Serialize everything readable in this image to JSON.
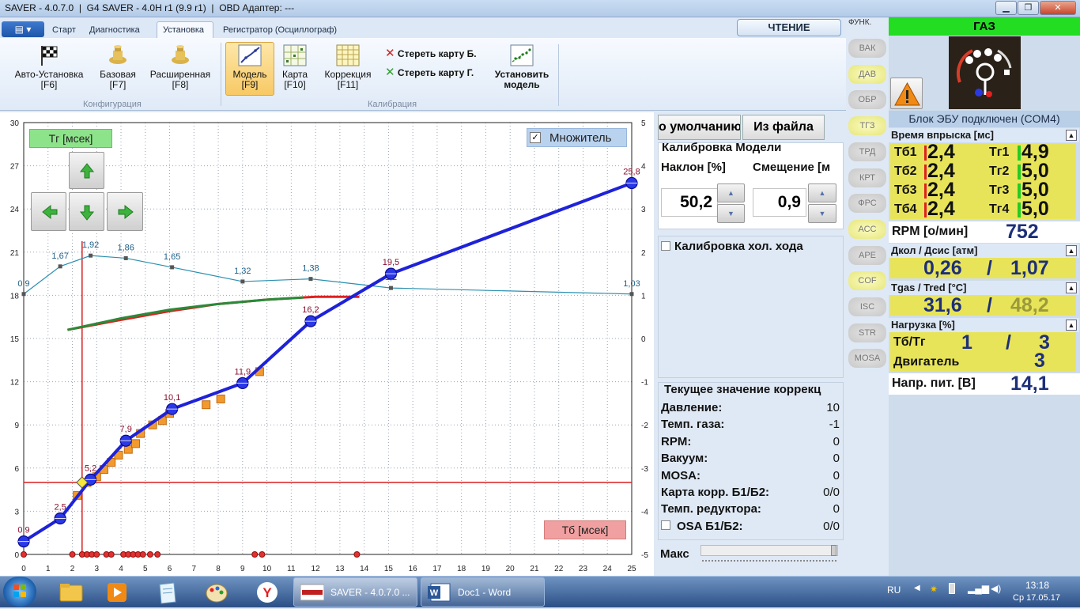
{
  "window": {
    "title": "SAVER - 4.0.7.0  |  G4 SAVER - 4.0H r1 (9.9 r1)  |  OBD Адаптер: ---",
    "min": "▁",
    "max": "❐",
    "close": "✕"
  },
  "ribbon": {
    "file_menu": "▤ ▾",
    "tabs": [
      "Старт",
      "Диагностика",
      "Установка",
      "Регистратор (Осциллограф)"
    ],
    "read_button": "ЧТЕНИЕ",
    "buttons": [
      {
        "label1": "Авто-Установка",
        "label2": "[F6]"
      },
      {
        "label1": "Базовая",
        "label2": "[F7]"
      },
      {
        "label1": "Расширенная",
        "label2": "[F8]"
      },
      {
        "label1": "Модель",
        "label2": "[F9]"
      },
      {
        "label1": "Карта",
        "label2": "[F10]"
      },
      {
        "label1": "Коррекция",
        "label2": "[F11]"
      },
      {
        "label1": "Установить",
        "label2": "модель"
      }
    ],
    "erase_b": "Стереть карту Б.",
    "erase_g": "Стереть карту Г.",
    "group_config": "Конфигурация",
    "group_calib": "Калибрация"
  },
  "chart_overlay": {
    "tg_label": "Тг [мсек]",
    "tb_label": "Тб [мсек]",
    "multiplier_label": "Множитель",
    "multiplier_checked": true
  },
  "chart_data": {
    "type": "line",
    "xlim": [
      0,
      25
    ],
    "ylim_left": [
      0,
      30
    ],
    "ylim_right": [
      -5,
      5
    ],
    "x_ticks": [
      0,
      1,
      2,
      3,
      4,
      5,
      6,
      7,
      8,
      9,
      10,
      11,
      12,
      13,
      14,
      15,
      16,
      17,
      18,
      19,
      20,
      21,
      22,
      23,
      24,
      25
    ],
    "y_ticks_left": [
      0,
      3,
      6,
      9,
      12,
      15,
      18,
      21,
      24,
      27,
      30
    ],
    "y_ticks_right": [
      -5,
      -4,
      -3,
      -2,
      -1,
      0,
      1,
      2,
      3,
      4,
      5
    ],
    "blue_curve": {
      "points": [
        [
          0,
          0.9
        ],
        [
          1.5,
          2.5
        ],
        [
          2.75,
          5.2
        ],
        [
          4.2,
          7.9
        ],
        [
          6.1,
          10.1
        ],
        [
          9,
          11.9
        ],
        [
          11.8,
          16.2
        ],
        [
          15.1,
          19.5
        ],
        [
          25,
          25.8
        ]
      ],
      "labels": [
        "0,9",
        "2,5",
        "5,2",
        "7,9",
        "10,1",
        "11,9",
        "16,2",
        "19,5",
        "25,8"
      ]
    },
    "factor_curve": {
      "points": [
        [
          0,
          1.03
        ],
        [
          1.5,
          1.67
        ],
        [
          2.75,
          1.92
        ],
        [
          4.2,
          1.86
        ],
        [
          6.1,
          1.65
        ],
        [
          9,
          1.32
        ],
        [
          11.8,
          1.38
        ],
        [
          15.1,
          1.17
        ],
        [
          25,
          1.03
        ]
      ],
      "labels": [
        "0,9",
        "1,67",
        "1,92",
        "1,86",
        "1,65",
        "1,32",
        "1,38",
        "1,2",
        "1,03"
      ]
    },
    "green_curve": {
      "points": [
        [
          1.8,
          15.6
        ],
        [
          4,
          16.4
        ],
        [
          6,
          17
        ],
        [
          8,
          17.4
        ],
        [
          10,
          17.7
        ],
        [
          11.5,
          17.85
        ]
      ]
    },
    "red_curve": {
      "points": [
        [
          1.8,
          15.6
        ],
        [
          4,
          16.3
        ],
        [
          6,
          16.9
        ],
        [
          8,
          17.4
        ],
        [
          10,
          17.7
        ],
        [
          12,
          17.9
        ],
        [
          13.8,
          17.9
        ]
      ]
    },
    "orange_squares": [
      [
        2.2,
        4.1
      ],
      [
        2.6,
        5
      ],
      [
        3.0,
        5.4
      ],
      [
        3.3,
        5.9
      ],
      [
        3.6,
        6.4
      ],
      [
        3.9,
        6.9
      ],
      [
        4.3,
        7.3
      ],
      [
        4.6,
        7.7
      ],
      [
        4.8,
        8.4
      ],
      [
        5.3,
        9.0
      ],
      [
        5.7,
        9.3
      ],
      [
        6.0,
        9.8
      ],
      [
        7.5,
        10.4
      ],
      [
        8.1,
        10.8
      ],
      [
        9.7,
        12.7
      ]
    ],
    "red_dots_x": [
      0,
      2.0,
      2.4,
      2.6,
      2.8,
      3.0,
      3.4,
      3.6,
      4.1,
      4.3,
      4.5,
      4.7,
      4.9,
      5.2,
      5.5,
      9.5,
      9.8,
      13.7
    ],
    "crosshair": {
      "x": 2.4,
      "y": 5.0
    }
  },
  "mid": {
    "btn_default": "о умолчанию",
    "btn_file": "Из файла",
    "calib_title": "Калибровка Модели",
    "slope_label": "Наклон [%]",
    "offset_label": "Смещение [м",
    "slope_value": "50,2",
    "offset_value": "0,9",
    "idle_calib": "Калибровка хол. хода",
    "corr_title": "Текущее значение коррекц",
    "rows": [
      [
        "Давление:",
        "10"
      ],
      [
        "Темп. газа:",
        "-1"
      ],
      [
        "RPM:",
        "0"
      ],
      [
        "Вакуум:",
        "0"
      ],
      [
        "MOSA:",
        "0"
      ],
      [
        "Карта корр. Б1/Б2:",
        "0/0"
      ],
      [
        "Темп. редуктора:",
        "0"
      ],
      [
        "OSA Б1/Б2:",
        "0/0"
      ]
    ],
    "max_label": "Макс"
  },
  "funk": {
    "title": "ФУНК.",
    "items": [
      "ВАК",
      "ДАВ",
      "ОБР",
      "ТГЗ",
      "ТРД",
      "КРТ",
      "ФРС",
      "АСС",
      "АРЕ",
      "COF",
      "ISC",
      "STR",
      "MOSA"
    ]
  },
  "right": {
    "gas_title": "ГАЗ",
    "ecu_status": "Блок ЭБУ подключен (COM4)",
    "inj_title": "Время впрыска [мс]",
    "tb": [
      [
        "Тб1",
        "2,4"
      ],
      [
        "Тб2",
        "2,4"
      ],
      [
        "Тб3",
        "2,4"
      ],
      [
        "Тб4",
        "2,4"
      ]
    ],
    "tg": [
      [
        "Тг1",
        "4,9"
      ],
      [
        "Тг2",
        "5,0"
      ],
      [
        "Тг3",
        "5,0"
      ],
      [
        "Тг4",
        "5,0"
      ]
    ],
    "rpm_label": "RPM [о/мин]",
    "rpm_value": "752",
    "press_title": "Дкол / Дсис [атм]",
    "press_value1": "0,26",
    "press_value2": "1,07",
    "temp_title": "Tgas / Tred [°C]",
    "temp_value1": "31,6",
    "temp_value2": "48,2",
    "load_title": "Нагрузка [%]",
    "load_label1": "Тб/Тг",
    "load_val1": "1",
    "load_val2": "3",
    "load_label2": "Двигатель",
    "load_val3": "3",
    "volt_label": "Напр. пит. [В]",
    "volt_value": "14,1",
    "slash": "/"
  },
  "taskbar": {
    "task1": "SAVER - 4.0.7.0 ...",
    "task2": "Doc1 - Word",
    "lang": "RU",
    "time": "13:18",
    "date": "Ср 17.05.17"
  }
}
